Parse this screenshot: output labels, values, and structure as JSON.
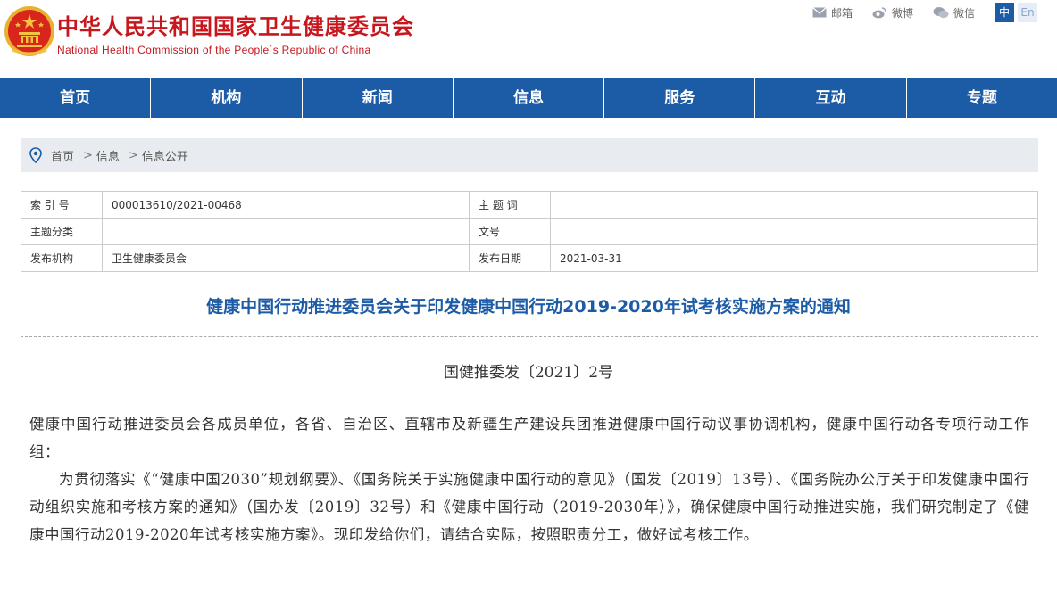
{
  "header": {
    "title": "中华人民共和国国家卫生健康委员会",
    "subtitle": "National Health Commission of the People´s Republic of China",
    "links": [
      {
        "label": "邮箱",
        "icon": "mail-icon"
      },
      {
        "label": "微博",
        "icon": "weibo-icon"
      },
      {
        "label": "微信",
        "icon": "wechat-icon"
      }
    ],
    "lang_zh": "中",
    "lang_en": "En"
  },
  "nav": {
    "items": [
      "首页",
      "机构",
      "新闻",
      "信息",
      "服务",
      "互动",
      "专题"
    ]
  },
  "breadcrumb": {
    "items": [
      "首页",
      "信息",
      "信息公开"
    ],
    "separator": ">"
  },
  "meta": {
    "index_label": "索 引 号",
    "index_value": "000013610/2021-00468",
    "subject_word_label": "主 题 词",
    "subject_word_value": "",
    "category_label": "主题分类",
    "category_value": "",
    "doc_no_label": "文号",
    "doc_no_value": "",
    "issuer_label": "发布机构",
    "issuer_value": "卫生健康委员会",
    "date_label": "发布日期",
    "date_value": "2021-03-31"
  },
  "document": {
    "title": "健康中国行动推进委员会关于印发健康中国行动2019-2020年试考核实施方案的通知",
    "number": "国健推委发〔2021〕2号",
    "paragraph1": "健康中国行动推进委员会各成员单位，各省、自治区、直辖市及新疆生产建设兵团推进健康中国行动议事协调机构，健康中国行动各专项行动工作组：",
    "paragraph2": "为贯彻落实《“健康中国2030”规划纲要》、《国务院关于实施健康中国行动的意见》（国发〔2019〕13号）、《国务院办公厅关于印发健康中国行动组织实施和考核方案的通知》（国办发〔2019〕32号）和《健康中国行动（2019-2030年）》，确保健康中国行动推进实施，我们研究制定了《健康中国行动2019-2020年试考核实施方案》。现印发给你们，请结合实际，按照职责分工，做好试考核工作。"
  },
  "colors": {
    "brand_red": "#c8161d",
    "nav_blue": "#1c5ba6",
    "breadcrumb_bg": "#e8ecf1"
  }
}
